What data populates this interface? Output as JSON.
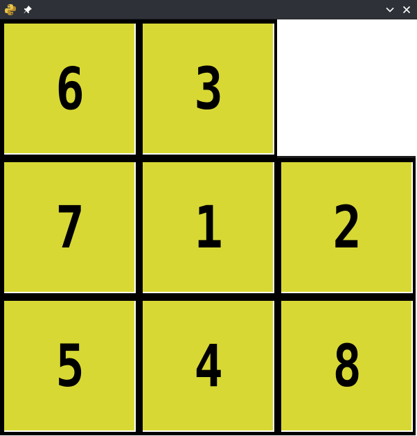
{
  "window": {
    "app_icon": "python-logo-icon",
    "pin_icon": "pin-icon",
    "minimize_icon": "chevron-down-icon",
    "close_icon": "close-icon"
  },
  "colors": {
    "tile": "#d8d835",
    "tile_border": "#000000",
    "board_bg": "#ffffff",
    "titlebar": "#2e3238"
  },
  "puzzle": {
    "rows": [
      [
        "6",
        "3",
        ""
      ],
      [
        "7",
        "1",
        "2"
      ],
      [
        "5",
        "4",
        "8"
      ]
    ]
  }
}
